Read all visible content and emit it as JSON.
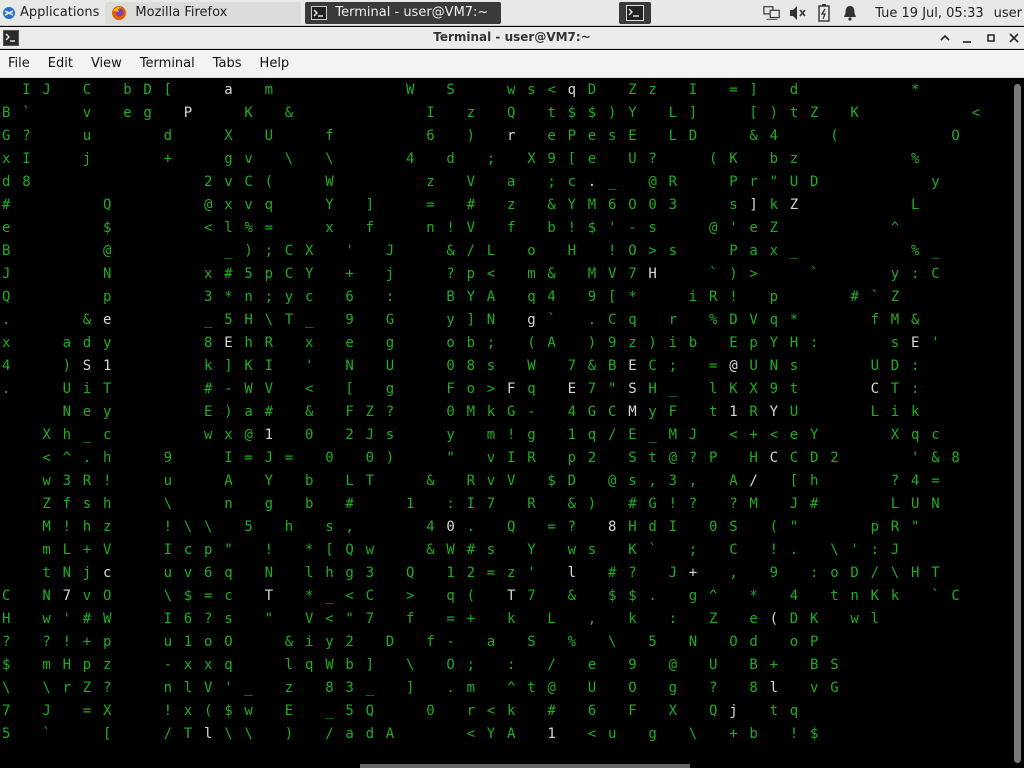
{
  "panel": {
    "apps_label": "Applications",
    "tasks": [
      {
        "label": "Mozilla Firefox",
        "icon": "firefox-icon"
      },
      {
        "label": "Terminal - user@VM7:~",
        "icon": "terminal-icon"
      }
    ],
    "clock": "Tue 19 Jul, 05:33",
    "user": "user",
    "tray_icons": [
      "network-icon",
      "mute-icon",
      "battery-icon",
      "bell-icon"
    ]
  },
  "window": {
    "title": "Terminal - user@VM7:~",
    "controls": [
      "minimize",
      "restore",
      "maximize",
      "close"
    ]
  },
  "menubar": [
    "File",
    "Edit",
    "View",
    "Terminal",
    "Tabs",
    "Help"
  ],
  "colors": {
    "matrix_green": "#1fae1f",
    "matrix_white": "#d8d8d8",
    "background": "#000000"
  },
  "matrix_rows": [
    " IJ C bD[  a m      W S  ws<qD Zz I =] d     *",
    "B`  v eg P  K &      I z Q t$$)Y L]  [)tZ K     <",
    "G?  u   d  X U  f    6 ) r ePesE LD  &4  (     O",
    "xI  j   +  gv \\ \\   4 d ; X9[e U?  (K bz     %",
    "d8        2vC(  W    z V a ;c._ @R  Pr\"UD     y",
    "#    Q    @xvq  Y ]  = # z &YM6O03  s]kZ     L",
    "e    $    <l%=  x f  n!V f b!$'-s  @'eZ     ^",
    "B    @     _);CX ' J  &/L o H !O>s  Pax_     %_",
    "J    N    x#5pCY + j  ?p< m& MV7H  `)>  `   y:C",
    "Q    p    3*n;yc 6 :  BYA q4 9[*  iR! p   #`Z",
    ".   &e    _5H\\T_ 9 G  y]N g` .Cq r %DVq*   fM&",
    "x  ady    8EhR x e g  ob; (A )9z)ib EpYH:   sE'",
    "4  )S1    k]KI ' N U  08s W 7&BEC; =@UNs   UD:",
    ".  UiT    #-WV < [ g  Fo>Fq E7\"SH_ lKX9t   CT:",
    "   Ney    E)a# & FZ?  0MkG- 4GCMyF t1RYU   Lik",
    "  Xh_c    wx@1 0 2Js  y m!g 1q/E_MJ <+<eY   Xqc",
    "  <^.h  9  I=J= 0 0)  \" vIR p2 St@?P HCCD2   '&8",
    "  w3R!  u  A Y b LT  & RvV $D @s,3, A/ [h   ?4=",
    "  Zfsh  \\  n g b #  1 :I7 R &) #G!? ?M J#   LUN",
    "  M!hz  !\\\\ 5 h s,   40. Q =? 8HdI 0S (\"   pR\"",
    "  mL+V  Icp\" ! *[Qw  &W#s Y ws K` ; C !. \\':J",
    "  tNjc  uv6q N lhg3 Q 12=z' l #? J+ , 9 :oD/\\HT",
    "C N7vO  \\$=c T *_<C > q( T7 & $$. g^ * 4 tnKk `C",
    "H w'#W  I6?s \" V<\"7 f =+ k L , k : Z e(DK wl",
    "? ?!+p  u1oO  &iy2 D f- a S % \\ 5 N Od oP",
    "$ mHpz  -xxq  lqWb] \\ O; : / e 9 @ U B+ BS",
    "\\ \\rZ?  nlV'_ z 83_ ] .m ^t@ U O g ? 8l vG",
    "7 J =X  !x($w E _5Q  0 r<k # 6 F X Qj tq",
    "5 `  [  /Tl\\\\ ) /adA   <YA 1 <u g \\ +b !$"
  ]
}
